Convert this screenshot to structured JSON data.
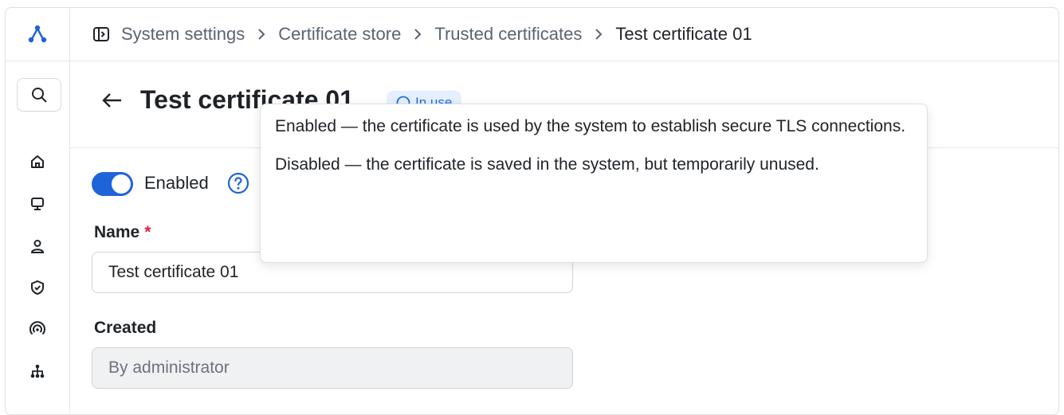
{
  "breadcrumb": {
    "items": [
      "System settings",
      "Certificate store",
      "Trusted certificates",
      "Test certificate 01"
    ]
  },
  "page": {
    "title": "Test certificate 01",
    "status_badge": "In use"
  },
  "form": {
    "enabled_label": "Enabled",
    "enabled": true,
    "name_label": "Name",
    "name_required_mark": "*",
    "name_value": "Test certificate 01",
    "created_label": "Created",
    "created_value": "By administrator"
  },
  "tooltip": {
    "enabled_text": "Enabled — the certificate is used by the system to establish secure TLS connections.",
    "disabled_text": "Disabled — the certificate is saved in the system, but temporarily unused."
  },
  "sidebar": {
    "icons": [
      "app-logo-icon",
      "search-icon",
      "home-icon",
      "monitor-icon",
      "user-icon",
      "shield-icon",
      "broadcast-icon",
      "hierarchy-icon"
    ]
  },
  "colors": {
    "accent": "#1f63d8",
    "badge_bg": "#e6efff",
    "badge_text": "#1f6fe5",
    "required": "#d7263d"
  }
}
